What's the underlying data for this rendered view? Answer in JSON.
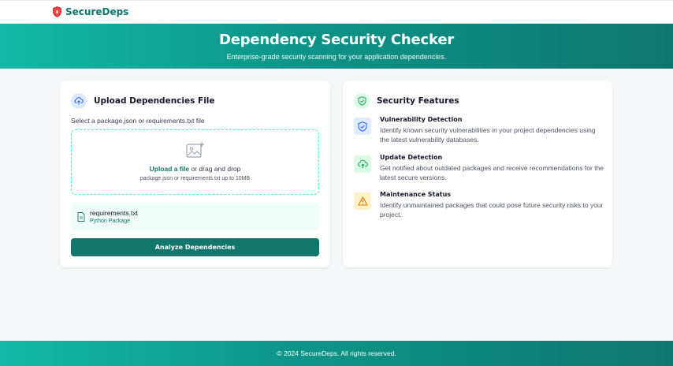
{
  "brand": {
    "name": "SecureDeps"
  },
  "hero": {
    "title": "Dependency Security Checker",
    "subtitle": "Enterprise-grade security scanning for your application dependencies."
  },
  "upload": {
    "title": "Upload Dependencies File",
    "select_label": "Select a package.json or requirements.txt file",
    "dropzone": {
      "link_text": "Upload a file",
      "rest_text": " or drag and drop",
      "hint": "package.json or requirements.txt up to 10MB"
    },
    "file": {
      "name": "requirements.txt",
      "type": "Python Package"
    },
    "button": "Analyze Dependencies"
  },
  "features": {
    "title": "Security Features",
    "items": [
      {
        "title": "Vulnerability Detection",
        "description": "Identify known security vulnerabilities in your project dependencies using the latest vulnerability databases.",
        "icon": "shield-check-icon",
        "color": "#2563eb"
      },
      {
        "title": "Update Detection",
        "description": "Get notified about outdated packages and receive recommendations for the latest secure versions.",
        "icon": "upload-cloud-icon",
        "color": "#16a34a"
      },
      {
        "title": "Maintenance Status",
        "description": "Identify unmaintained packages that could pose future security risks to your project.",
        "icon": "warning-icon",
        "color": "#d97706"
      }
    ]
  },
  "footer": {
    "text": "© 2024 SecureDeps. All rights reserved."
  },
  "colors": {
    "accent": "#0f766e",
    "accent_light": "#14b8a6",
    "button": "#11766b"
  }
}
